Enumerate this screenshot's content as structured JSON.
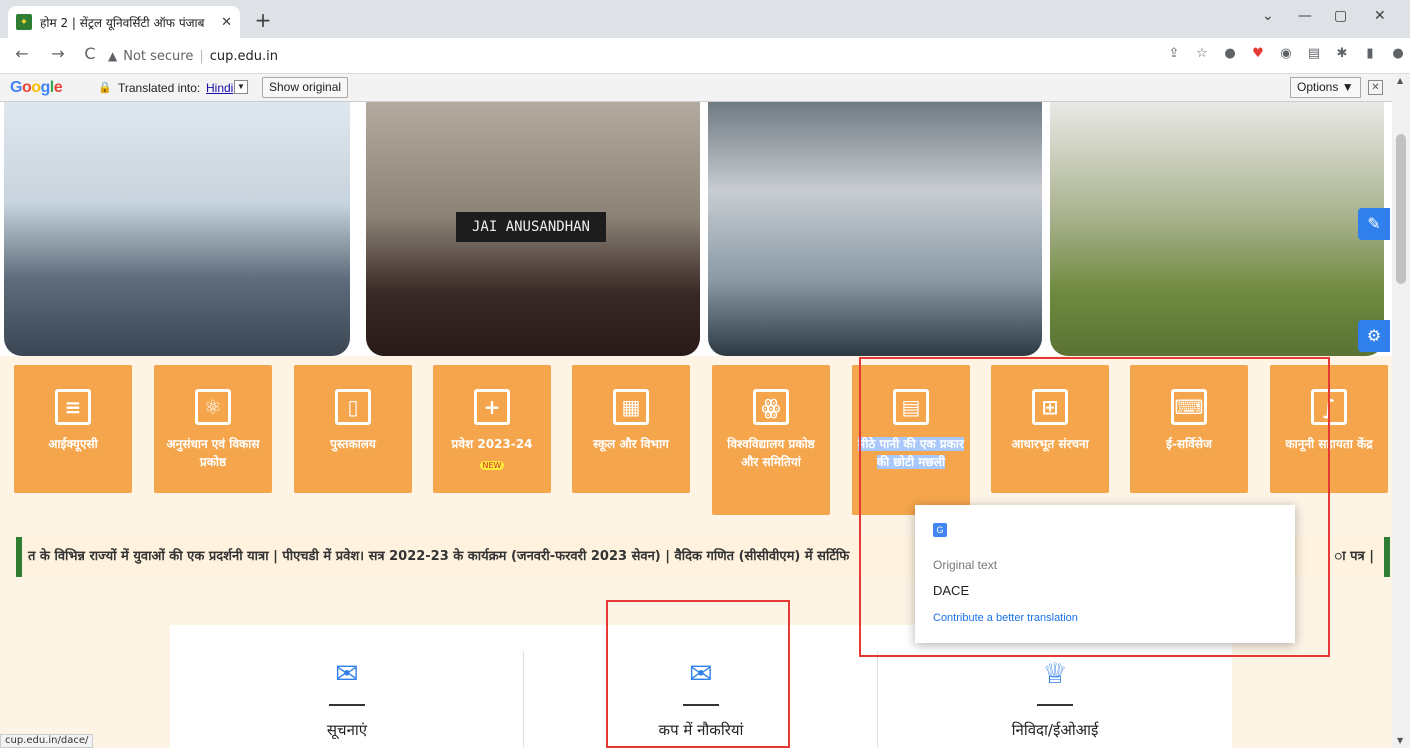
{
  "browser": {
    "tab_title": "होम 2 | सेंट्रल यूनिवर्सिटी ऑफ पंजाब",
    "url_warning": "Not secure",
    "url": "cup.edu.in",
    "status_url": "cup.edu.in/dace/"
  },
  "translate_bar": {
    "logo": "Google",
    "label": "Translated into:",
    "language": "Hindi",
    "show_original": "Show original",
    "options": "Options ▼"
  },
  "slider": {
    "banner_text": "JAI ANUSANDHAN"
  },
  "tiles": [
    {
      "label": "आईक्यूएसी",
      "icon": "document-icon"
    },
    {
      "label": "अनुसंधान एवं विकास प्रकोष्ठ",
      "icon": "atom-icon"
    },
    {
      "label": "पुस्तकालय",
      "icon": "book-icon"
    },
    {
      "label": "प्रवेश 2023-24",
      "badge": "NEW",
      "icon": "admission-icon"
    },
    {
      "label": "स्कूल और विभाग",
      "icon": "building-icon"
    },
    {
      "label": "विश्वविद्यालय प्रकोष्ठ और समितियां",
      "icon": "people-icon"
    },
    {
      "label": "मीठे पानी की एक प्रकार की छोटी मछली",
      "icon": "calculator-icon"
    },
    {
      "label": "आधारभूत संरचना",
      "icon": "structure-icon"
    },
    {
      "label": "ई-सर्विसेज",
      "icon": "laptop-icon"
    },
    {
      "label": "कानूनी सहायता केंद्र",
      "icon": "scroll-icon"
    }
  ],
  "ticker": {
    "text": "त के विभिन्न राज्यों में युवाओं की एक प्रदर्शनी यात्रा  |  पीएचडी में प्रवेश। सत्र 2022-23 के कार्यक्रम (जनवरी-फरवरी 2023 सेवन)  |  वैदिक गणित (सीसीवीएम) में सर्टिफि",
    "text_right": "ा पत्र  |"
  },
  "popup": {
    "original_label": "Original text",
    "original_value": "DACE",
    "contribute": "Contribute a better translation"
  },
  "cards": [
    {
      "label": "सूचनाएं",
      "icon": "envelope-check-icon"
    },
    {
      "label": "कप में नौकरियां",
      "icon": "envelope-check-icon"
    },
    {
      "label": "निविदा/ईओआई",
      "icon": "gift-icon"
    }
  ]
}
